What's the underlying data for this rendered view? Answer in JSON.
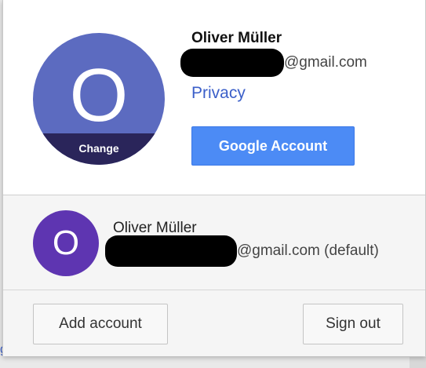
{
  "background": {
    "link_text": "g"
  },
  "profile": {
    "name": "Oliver Müller",
    "email_suffix": "@gmail.com",
    "avatar_initial": "O",
    "avatar_color": "#5c6bc0",
    "change_label": "Change",
    "privacy_label": "Privacy",
    "google_account_label": "Google Account",
    "accent_color": "#4c8bf5"
  },
  "accounts": [
    {
      "name": "Oliver Müller",
      "email_suffix": "@gmail.com (default)",
      "avatar_initial": "O",
      "avatar_color": "#5e35b1"
    }
  ],
  "footer": {
    "add_account_label": "Add account",
    "sign_out_label": "Sign out"
  }
}
